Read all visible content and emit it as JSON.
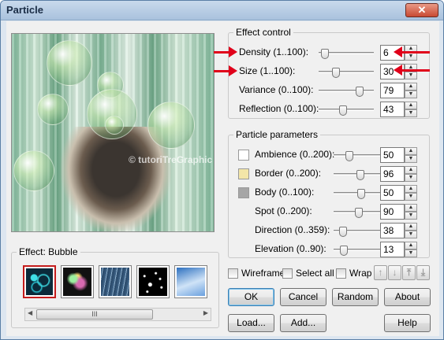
{
  "window": {
    "title": "Particle",
    "close_glyph": "✕"
  },
  "preview": {
    "watermark": "© tutoriTreGraphic"
  },
  "effect": {
    "legend": "Effect: Bubble",
    "thumbnails": [
      {
        "name": "bubble",
        "colors": [
          "#0b2a3a",
          "#3fe0e8"
        ],
        "selected": true
      },
      {
        "name": "glow",
        "colors": [
          "#111",
          "#d86ab0"
        ],
        "selected": false
      },
      {
        "name": "rain",
        "colors": [
          "#3a5d80",
          "#8fb0cc"
        ],
        "selected": false
      },
      {
        "name": "stars",
        "colors": [
          "#000",
          "#fff"
        ],
        "selected": false
      },
      {
        "name": "sky",
        "colors": [
          "#2c6fbf",
          "#cfe3f7"
        ],
        "selected": false
      }
    ],
    "scroll_glyph": "III"
  },
  "effect_control": {
    "legend": "Effect control",
    "rows": [
      {
        "label": "Density (1..100):",
        "value": "6",
        "slider": 0.05
      },
      {
        "label": "Size (1..100):",
        "value": "30",
        "slider": 0.29
      },
      {
        "label": "Variance (0..100):",
        "value": "79",
        "slider": 0.79
      },
      {
        "label": "Reflection (0..100):",
        "value": "43",
        "slider": 0.43
      }
    ]
  },
  "particle_parameters": {
    "legend": "Particle parameters",
    "rows": [
      {
        "label": "Ambience (0..200):",
        "value": "50",
        "slider": 0.25,
        "swatch": "#ffffff"
      },
      {
        "label": "Border (0..200):",
        "value": "96",
        "slider": 0.48,
        "swatch": "#f3e6a8"
      },
      {
        "label": "Body (0..100):",
        "value": "50",
        "slider": 0.5,
        "swatch": "#a6a6a6"
      },
      {
        "label": "Spot (0..200):",
        "value": "90",
        "slider": 0.45
      },
      {
        "label": "Direction (0..359):",
        "value": "38",
        "slider": 0.11
      },
      {
        "label": "Elevation (0..90):",
        "value": "13",
        "slider": 0.14
      }
    ]
  },
  "options": {
    "wireframe": "Wireframe",
    "select_all": "Select all",
    "wrap": "Wrap"
  },
  "arrows": [
    "↑",
    "↓",
    "⤒",
    "⤓"
  ],
  "buttons": {
    "ok": "OK",
    "cancel": "Cancel",
    "random": "Random",
    "about": "About",
    "load": "Load...",
    "add": "Add...",
    "help": "Help"
  },
  "colors": {
    "highlight_red": "#e0001a",
    "selection_border": "#c41c1c"
  }
}
